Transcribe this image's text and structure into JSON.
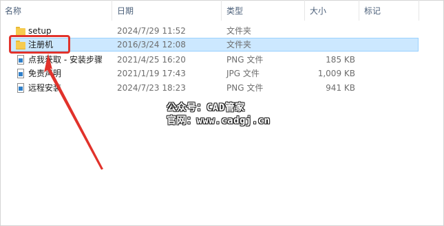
{
  "columns": {
    "name": "名称",
    "date": "日期",
    "type": "类型",
    "size": "大小",
    "tags": "标记"
  },
  "files": [
    {
      "name": "setup",
      "date": "2024/7/29 11:52",
      "type": "文件夹",
      "size": "",
      "icon": "folder-icon"
    },
    {
      "name": "注册机",
      "date": "2016/3/24 12:08",
      "type": "文件夹",
      "size": "",
      "icon": "folder-icon",
      "selected": true
    },
    {
      "name": "点我获取 - 安装步骤",
      "date": "2021/4/25 16:20",
      "type": "PNG 文件",
      "size": "185 KB",
      "icon": "image-file-icon"
    },
    {
      "name": "免责声明",
      "date": "2021/1/19 17:43",
      "type": "JPG 文件",
      "size": "1,009 KB",
      "icon": "image-file-icon"
    },
    {
      "name": "远程安装",
      "date": "2024/7/23 18:23",
      "type": "PNG 文件",
      "size": "941 KB",
      "icon": "image-file-icon"
    }
  ],
  "watermark": {
    "line1": "公众号：CAD管家",
    "line2": "官网：www.cadgj.cn"
  },
  "colors": {
    "selection": "#cce8ff",
    "annotation": "#e1322b"
  }
}
